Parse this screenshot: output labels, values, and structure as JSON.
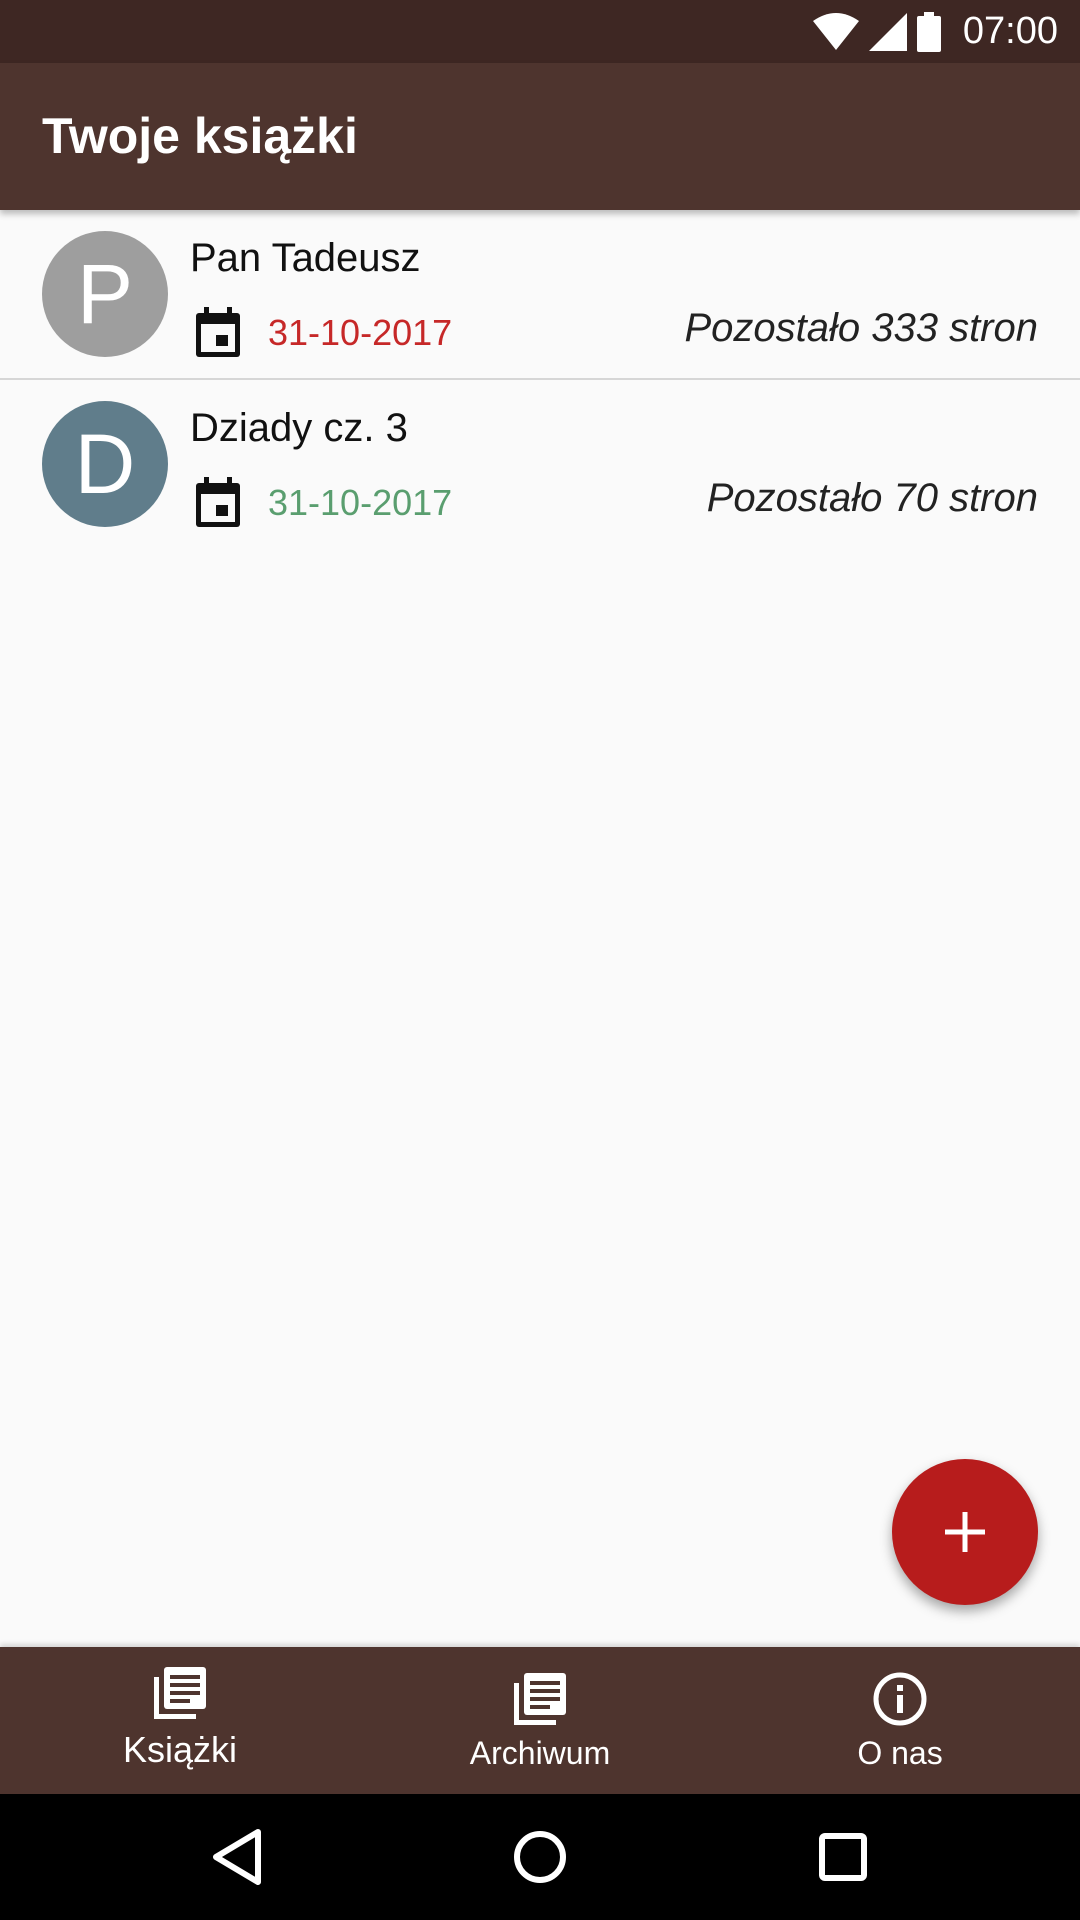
{
  "status_bar": {
    "time": "07:00",
    "icons": [
      "wifi-icon",
      "signal-icon",
      "battery-icon"
    ]
  },
  "app_bar": {
    "title": "Twoje książki"
  },
  "colors": {
    "status_bar_bg": "#3e2723",
    "app_bar_bg": "#4e342e",
    "overdue_date": "#c62828",
    "ok_date": "#5a9e6f",
    "fab_bg": "#b71c1c"
  },
  "books": [
    {
      "initial": "P",
      "avatar_color": "#9e9e9e",
      "title": "Pan Tadeusz",
      "date": "31-10-2017",
      "date_color": "#c62828",
      "remaining": "Pozostało 333 stron"
    },
    {
      "initial": "D",
      "avatar_color": "#607d8b",
      "title": "Dziady cz. 3",
      "date": "31-10-2017",
      "date_color": "#5a9e6f",
      "remaining": "Pozostało 70 stron"
    }
  ],
  "fab": {
    "icon": "plus-icon"
  },
  "bottom_nav": {
    "items": [
      {
        "label": "Książki",
        "icon": "library-books-icon",
        "active": true
      },
      {
        "label": "Archiwum",
        "icon": "library-books-icon",
        "active": false
      },
      {
        "label": "O nas",
        "icon": "info-icon",
        "active": false
      }
    ]
  },
  "system_nav": {
    "buttons": [
      "back-icon",
      "home-icon",
      "recents-icon"
    ]
  }
}
